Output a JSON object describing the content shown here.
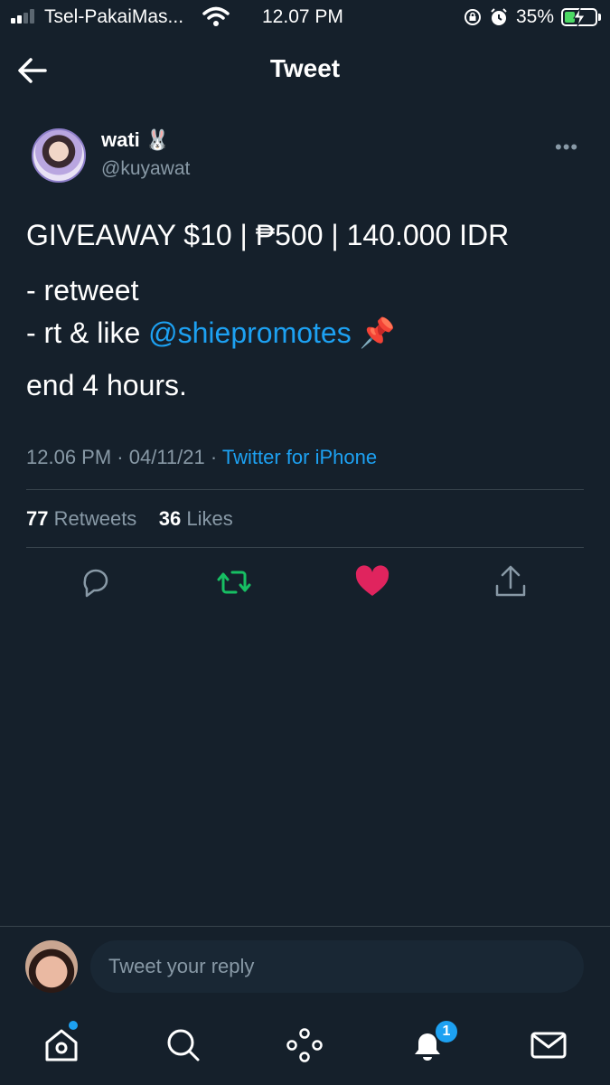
{
  "status_bar": {
    "carrier": "Tsel-PakaiMas...",
    "time": "12.07 PM",
    "battery": "35%",
    "battery_level": 0.35
  },
  "header": {
    "title": "Tweet",
    "back_icon": "arrow-left-icon"
  },
  "author": {
    "name": "wati 🐰",
    "handle": "@kuyawat"
  },
  "tweet": {
    "line1": "GIVEAWAY $10 | ₱500 | 140.000 IDR",
    "line2": "- retweet",
    "line3_prefix": "- rt & like ",
    "line3_mention": "@shiepromotes",
    "line3_suffix": " 📌",
    "line4": "end 4 hours."
  },
  "meta": {
    "time": "12.06 PM",
    "sep": " · ",
    "date": "04/11/21",
    "sep2": " · ",
    "source": "Twitter for iPhone"
  },
  "stats": {
    "retweets_count": "77",
    "retweets_label": " Retweets",
    "likes_count": "36",
    "likes_label": " Likes"
  },
  "colors": {
    "background": "#15202b",
    "accent": "#1da1f2",
    "retweet": "#17bf63",
    "like": "#e0245e",
    "muted": "#8899a6"
  },
  "reply": {
    "placeholder": "Tweet your reply"
  },
  "nav": {
    "notifications_badge": "1"
  }
}
